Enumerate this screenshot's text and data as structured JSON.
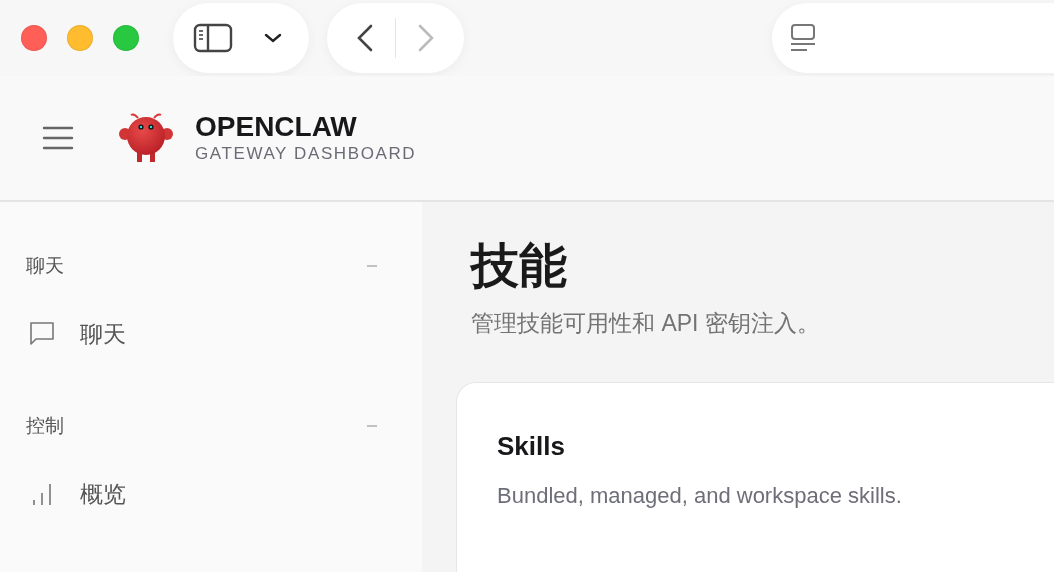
{
  "browser": {
    "back": {
      "disabled": false
    },
    "forward": {
      "disabled": true
    }
  },
  "header": {
    "title": "OPENCLAW",
    "subtitle": "GATEWAY DASHBOARD"
  },
  "sidebar": {
    "groups": [
      {
        "label": "聊天",
        "expanded": true,
        "items": [
          {
            "label": "聊天",
            "kind": "chat",
            "selected": false
          }
        ]
      },
      {
        "label": "控制",
        "expanded": true,
        "items": [
          {
            "label": "概览",
            "kind": "overview",
            "selected": false
          }
        ]
      }
    ]
  },
  "page": {
    "title": "技能",
    "subtitle": "管理技能可用性和 API 密钥注入。"
  },
  "card": {
    "title": "Skills",
    "description": "Bundled, managed, and workspace skills."
  }
}
